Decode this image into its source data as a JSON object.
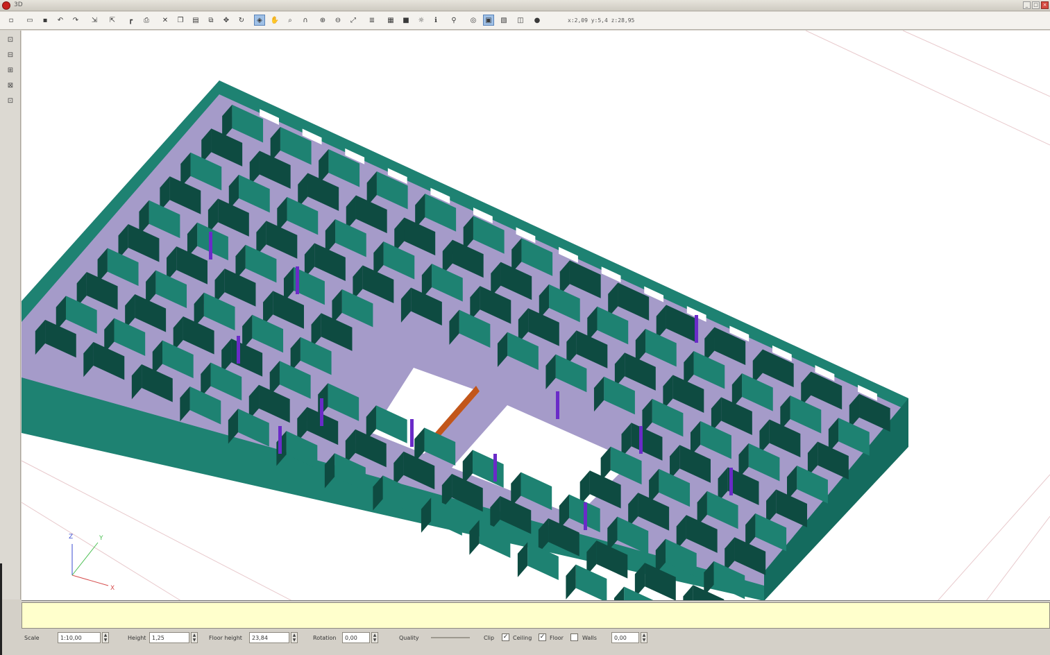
{
  "window": {
    "title": "3D"
  },
  "toolbar": {
    "icons": [
      "new-icon",
      "open-icon",
      "save-icon",
      "undo-icon",
      "redo-icon",
      "import-icon",
      "export-icon",
      "wall-icon",
      "print-icon",
      "delete-icon",
      "copy-icon",
      "paste-icon",
      "clone-icon",
      "move-icon",
      "rotate-icon",
      "select-icon",
      "pan-icon",
      "zoom-icon",
      "orbit-icon",
      "zoom-in-icon",
      "zoom-out-icon",
      "fit-icon",
      "layers-icon",
      "grid-icon",
      "render-icon",
      "light-icon",
      "info-icon",
      "walk-icon",
      "camera-icon",
      "view-icon",
      "plan-icon",
      "split-icon",
      "globe-icon"
    ],
    "coord_readout": "x:2,09 y:5,4 z:28,95"
  },
  "left_rail": {
    "icons": [
      "select-tool-icon",
      "wall-tool-icon",
      "door-tool-icon",
      "window-tool-icon",
      "furniture-tool-icon"
    ]
  },
  "axis": {
    "x": "X",
    "y": "Y",
    "z": "Z"
  },
  "status": {
    "scale_label": "Scale",
    "scale_value": "1:10,00",
    "height_label": "Height",
    "height_value": "1,25",
    "floor_height_label": "Floor height",
    "floor_height_value": "23,84",
    "rotation_label": "Rotation",
    "rotation_value": "0,00",
    "quality_label": "Quality",
    "clip_label": "Clip",
    "ceiling_label": "Ceiling",
    "ceiling_checked": "✓",
    "floor_label": "Floor",
    "floor_checked": "✓",
    "walls_label": "Walls",
    "walls_checked": "",
    "walls_value": "0,00"
  },
  "colors": {
    "wall": "#1e8272",
    "wall_dark": "#0e4b41",
    "floor": "#a59bc9",
    "column": "#6a2bc8",
    "message": "#ffffcc"
  }
}
